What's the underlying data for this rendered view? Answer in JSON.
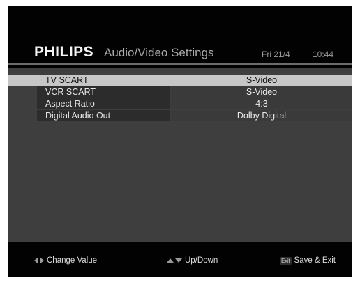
{
  "header": {
    "brand": "PHILIPS",
    "title": "Audio/Video Settings",
    "date": "Fri 21/4",
    "time": "10:44"
  },
  "settings": [
    {
      "label": "TV SCART",
      "value": "S-Video",
      "selected": true
    },
    {
      "label": "VCR SCART",
      "value": "S-Video",
      "selected": false
    },
    {
      "label": "Aspect Ratio",
      "value": "4:3",
      "selected": false
    },
    {
      "label": "Digital Audio Out",
      "value": "Dolby Digital",
      "selected": false
    }
  ],
  "footer": {
    "change_value": "Change Value",
    "up_down": "Up/Down",
    "exit_key": "Exit",
    "save_exit": "Save & Exit"
  },
  "colors": {
    "background": "#020202",
    "panel": "#3e3e3e",
    "selected_row": "#c6c6c6"
  },
  "icons": [
    "left-right-arrow-icon",
    "up-down-arrow-icon",
    "exit-key-icon"
  ]
}
